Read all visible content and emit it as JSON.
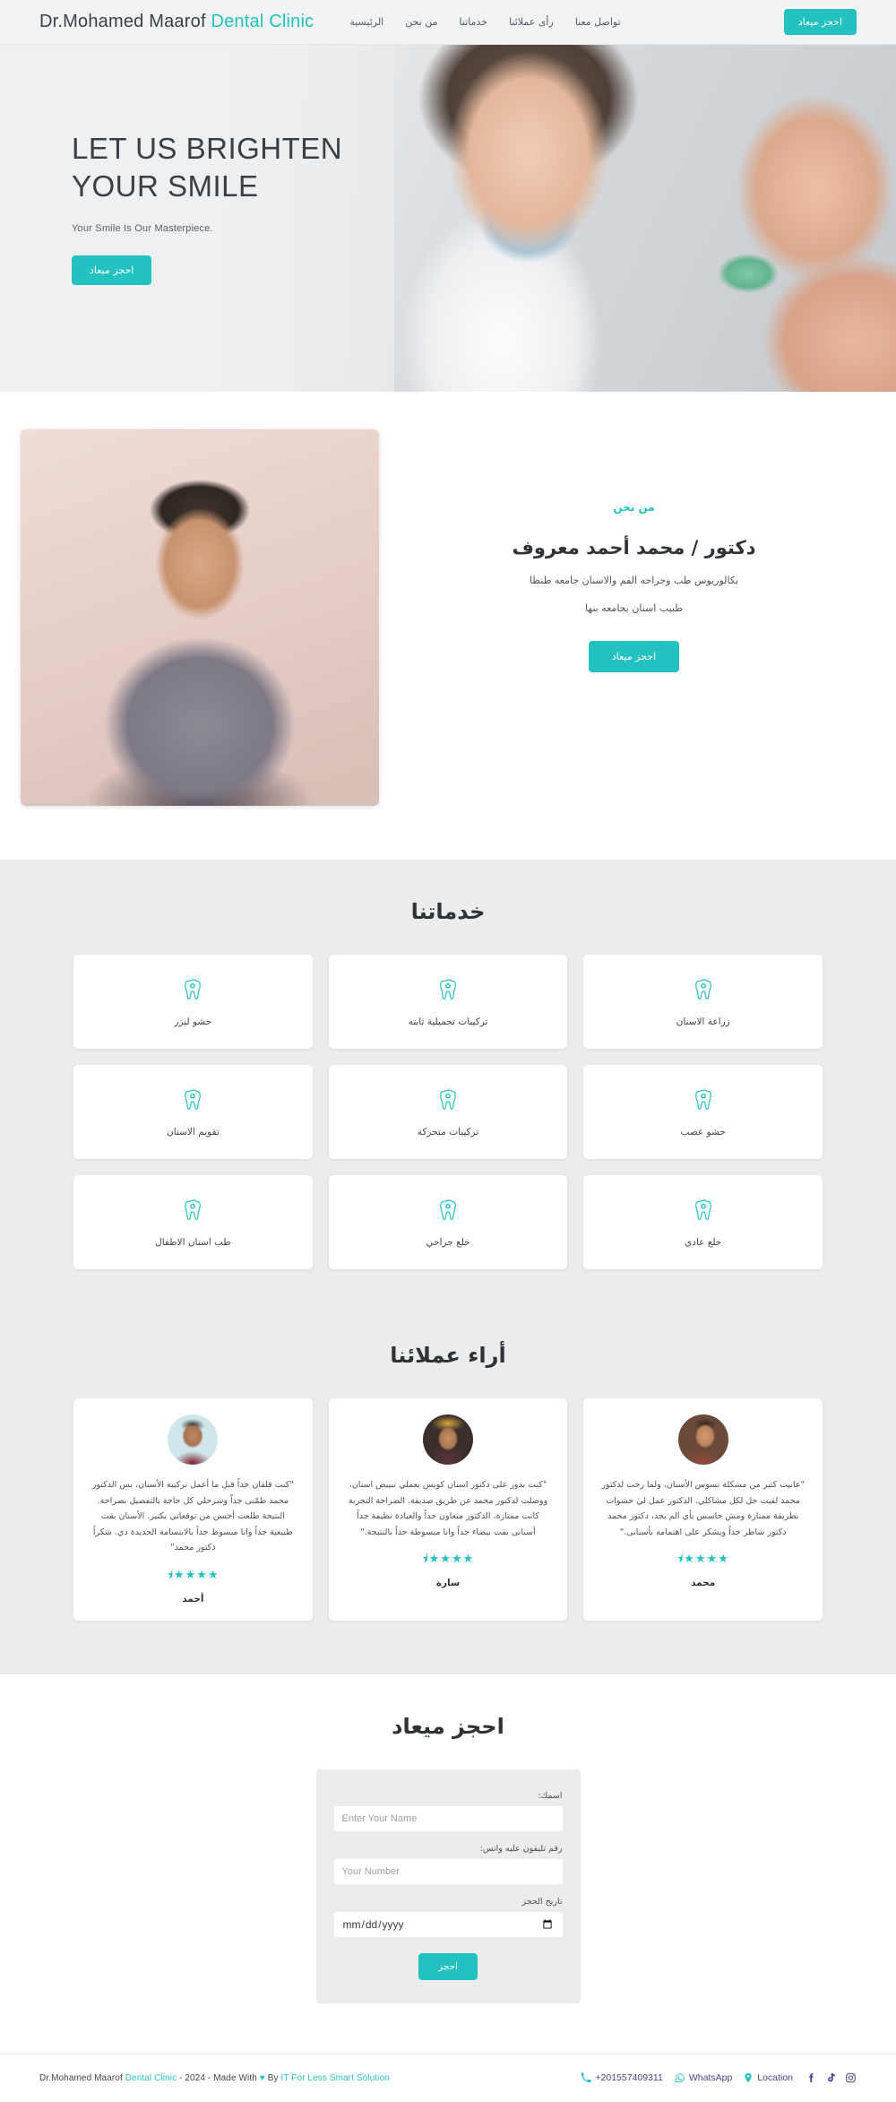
{
  "colors": {
    "accent": "#23c1bf",
    "header_bg": "#f2f3f4",
    "section_grey": "#ececec",
    "text_dark": "#2e3338",
    "footer_purple": "#4b3f8f"
  },
  "header": {
    "brand_main": "Dr.Mohamed Maarof",
    "brand_accent": "Dental Clinic",
    "nav": [
      {
        "label": "الرئيسية",
        "name": "nav-home"
      },
      {
        "label": "من نحن",
        "name": "nav-about"
      },
      {
        "label": "خدماتنا",
        "name": "nav-services"
      },
      {
        "label": "رأى عملائنا",
        "name": "nav-testimonials"
      },
      {
        "label": "تواصل معنا",
        "name": "nav-contact"
      }
    ],
    "cta_label": "احجز ميعاد"
  },
  "hero": {
    "title_line1": "LET US BRIGHTEN",
    "title_line2": "YOUR SMILE",
    "subtitle": "Your Smile Is Our Masterpiece.",
    "button_label": "احجز ميعاد"
  },
  "about": {
    "kicker": "من نحن",
    "name": "دكتور / محمد أحمد معروف",
    "line1": "بكالوريوس طب وجراحه الفم والاسنان جامعه طنطا",
    "line2": "طبيب اسنان بجامعه بنها",
    "button_label": "احجز ميعاد"
  },
  "services": {
    "title": "خدماتنا",
    "icon": "tooth-icon",
    "items": [
      {
        "label": "زراعة الاسنان"
      },
      {
        "label": "تركيبات تجميلية ثابته"
      },
      {
        "label": "حشو ليزر"
      },
      {
        "label": "حشو عصب"
      },
      {
        "label": "تركيبات متحركة"
      },
      {
        "label": "تقويم الاسنان"
      },
      {
        "label": "خلع عادي"
      },
      {
        "label": "خلع جراحي"
      },
      {
        "label": "طب اسنان الاطفال"
      }
    ]
  },
  "testimonials": {
    "title": "أراء عملائنا",
    "items": [
      {
        "quote": "\"عانيت كتير من مشكلة تسوس الأسنان، ولما رحت لدكتور محمد لقيت حل لكل مشاكلي. الدكتور عمل لي حشوات بطريقة ممتازة ومش حاسس بأي الم بجد، دكتور محمد دكتور شاطر جداً ويشكر على اهتمامه بأسنانى.\"",
        "stars": "★★★★⯨",
        "rating": 4.5,
        "name": "محمد",
        "avatar": "a3"
      },
      {
        "quote": "\"كنت بدور على دكتور اسنان كويس يعملي تبييض اسنان، ووصلت لدكتور محمد عن طريق صديقة. الصراحة التجربة كانت ممتازة، الدكتور متعاون جداً والعيادة نظيفة جداً أسنانى بقت بيضاء جداً وانا مبسوطة جداً بالنتيجة.\"",
        "stars": "★★★★⯨",
        "rating": 4.5,
        "name": "سارة",
        "avatar": "a2"
      },
      {
        "quote": "\"كنت قلقان جداً قبل ما أعمل تركيبة الأسنان، بس الدكتور محمد طمّنى جداً وشرحلي كل حاجة بالتفصيل بصراحة. النتيجة طلعت أحسن من توقعاتي بكتير. الأسنان بقت طبيعية جداً وانا مبسوط جداً بالابتسامة الجديدة دي. شكراً دكتور محمد\"",
        "stars": "★★★★⯨",
        "rating": 4.5,
        "name": "أحمد",
        "avatar": "a1"
      }
    ]
  },
  "booking": {
    "title": "احجز ميعاد",
    "name_label": "اسمك:",
    "name_placeholder": "Enter Your Name",
    "phone_label": "رقم تليفون عليه واتس:",
    "phone_placeholder": "Your Number",
    "date_label": "تاريخ الحجز",
    "date_placeholder": "mm/dd/yyyy",
    "submit_label": "احجز"
  },
  "footer": {
    "credit_brand": "Dr.Mohamed Maarof ",
    "credit_accent": "Dental Clinic",
    "credit_mid": " - 2024 - Made With ",
    "credit_heart": "♥",
    "credit_by": " By ",
    "credit_company": "IT For Less Smart Solution",
    "phone": "+201557409311",
    "whatsapp_label": "WhatsApp",
    "location_label": "Location",
    "socials": [
      "facebook-icon",
      "tiktok-icon",
      "instagram-icon"
    ]
  }
}
